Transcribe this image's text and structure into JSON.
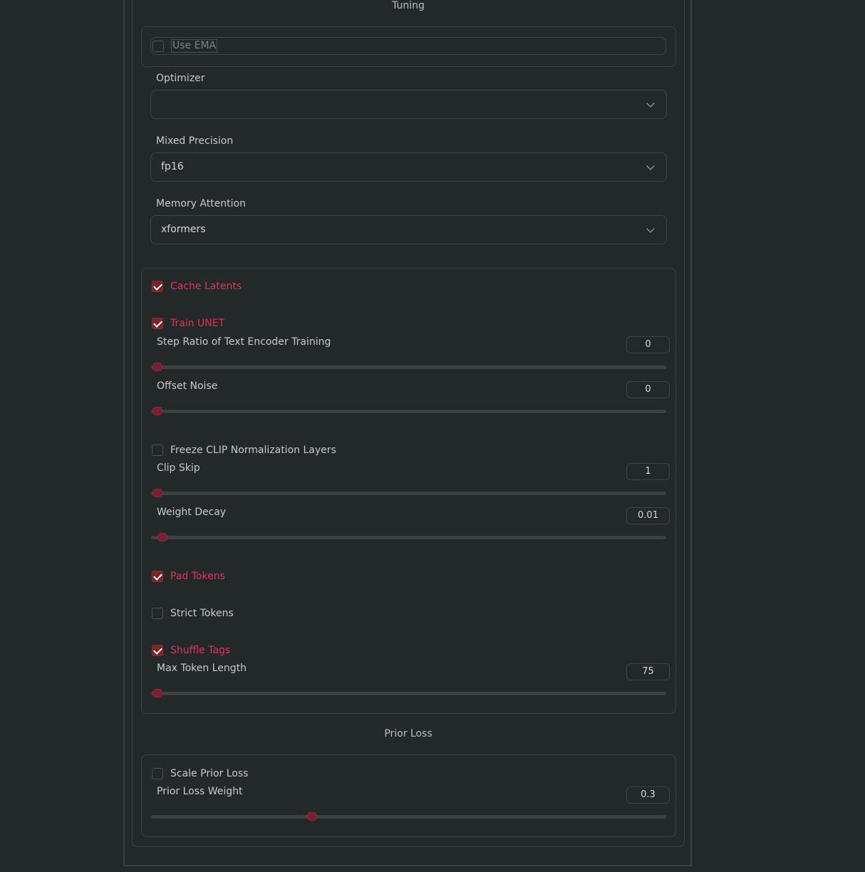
{
  "tuning": {
    "title": "Tuning",
    "use_ema": {
      "label": "Use EMA",
      "checked": false
    },
    "optimizer": {
      "label": "Optimizer",
      "value": ""
    },
    "mixed_precision": {
      "label": "Mixed Precision",
      "value": "fp16"
    },
    "memory_attention": {
      "label": "Memory Attention",
      "value": "xformers"
    },
    "cache_latents": {
      "label": "Cache Latents",
      "checked": true
    },
    "train_unet": {
      "label": "Train UNET",
      "checked": true
    },
    "step_ratio": {
      "label": "Step Ratio of Text Encoder Training",
      "value": "0",
      "level": 0
    },
    "offset_noise": {
      "label": "Offset Noise",
      "value": "0",
      "level": 0
    },
    "freeze_clip": {
      "label": "Freeze CLIP Normalization Layers",
      "checked": false
    },
    "clip_skip": {
      "label": "Clip Skip",
      "value": "1",
      "level": 0
    },
    "weight_decay": {
      "label": "Weight Decay",
      "value": "0.01",
      "level": 0.01
    },
    "pad_tokens": {
      "label": "Pad Tokens",
      "checked": true
    },
    "strict_tokens": {
      "label": "Strict Tokens",
      "checked": false
    },
    "shuffle_tags": {
      "label": "Shuffle Tags",
      "checked": true
    },
    "max_token_length": {
      "label": "Max Token Length",
      "value": "75",
      "level": 0
    }
  },
  "prior_loss": {
    "title": "Prior Loss",
    "scale_prior_loss": {
      "label": "Scale Prior Loss",
      "checked": false
    },
    "prior_loss_weight": {
      "label": "Prior Loss Weight",
      "value": "0.3",
      "level": 0.3
    }
  },
  "colors": {
    "accent": "#e0325b",
    "checkbox_checked": "#7c2527",
    "slider_thumb": "#7a1e30",
    "background": "#232829"
  },
  "icons": {
    "dropdown": "chevron-down-icon",
    "checkmark": "checkmark-icon"
  }
}
